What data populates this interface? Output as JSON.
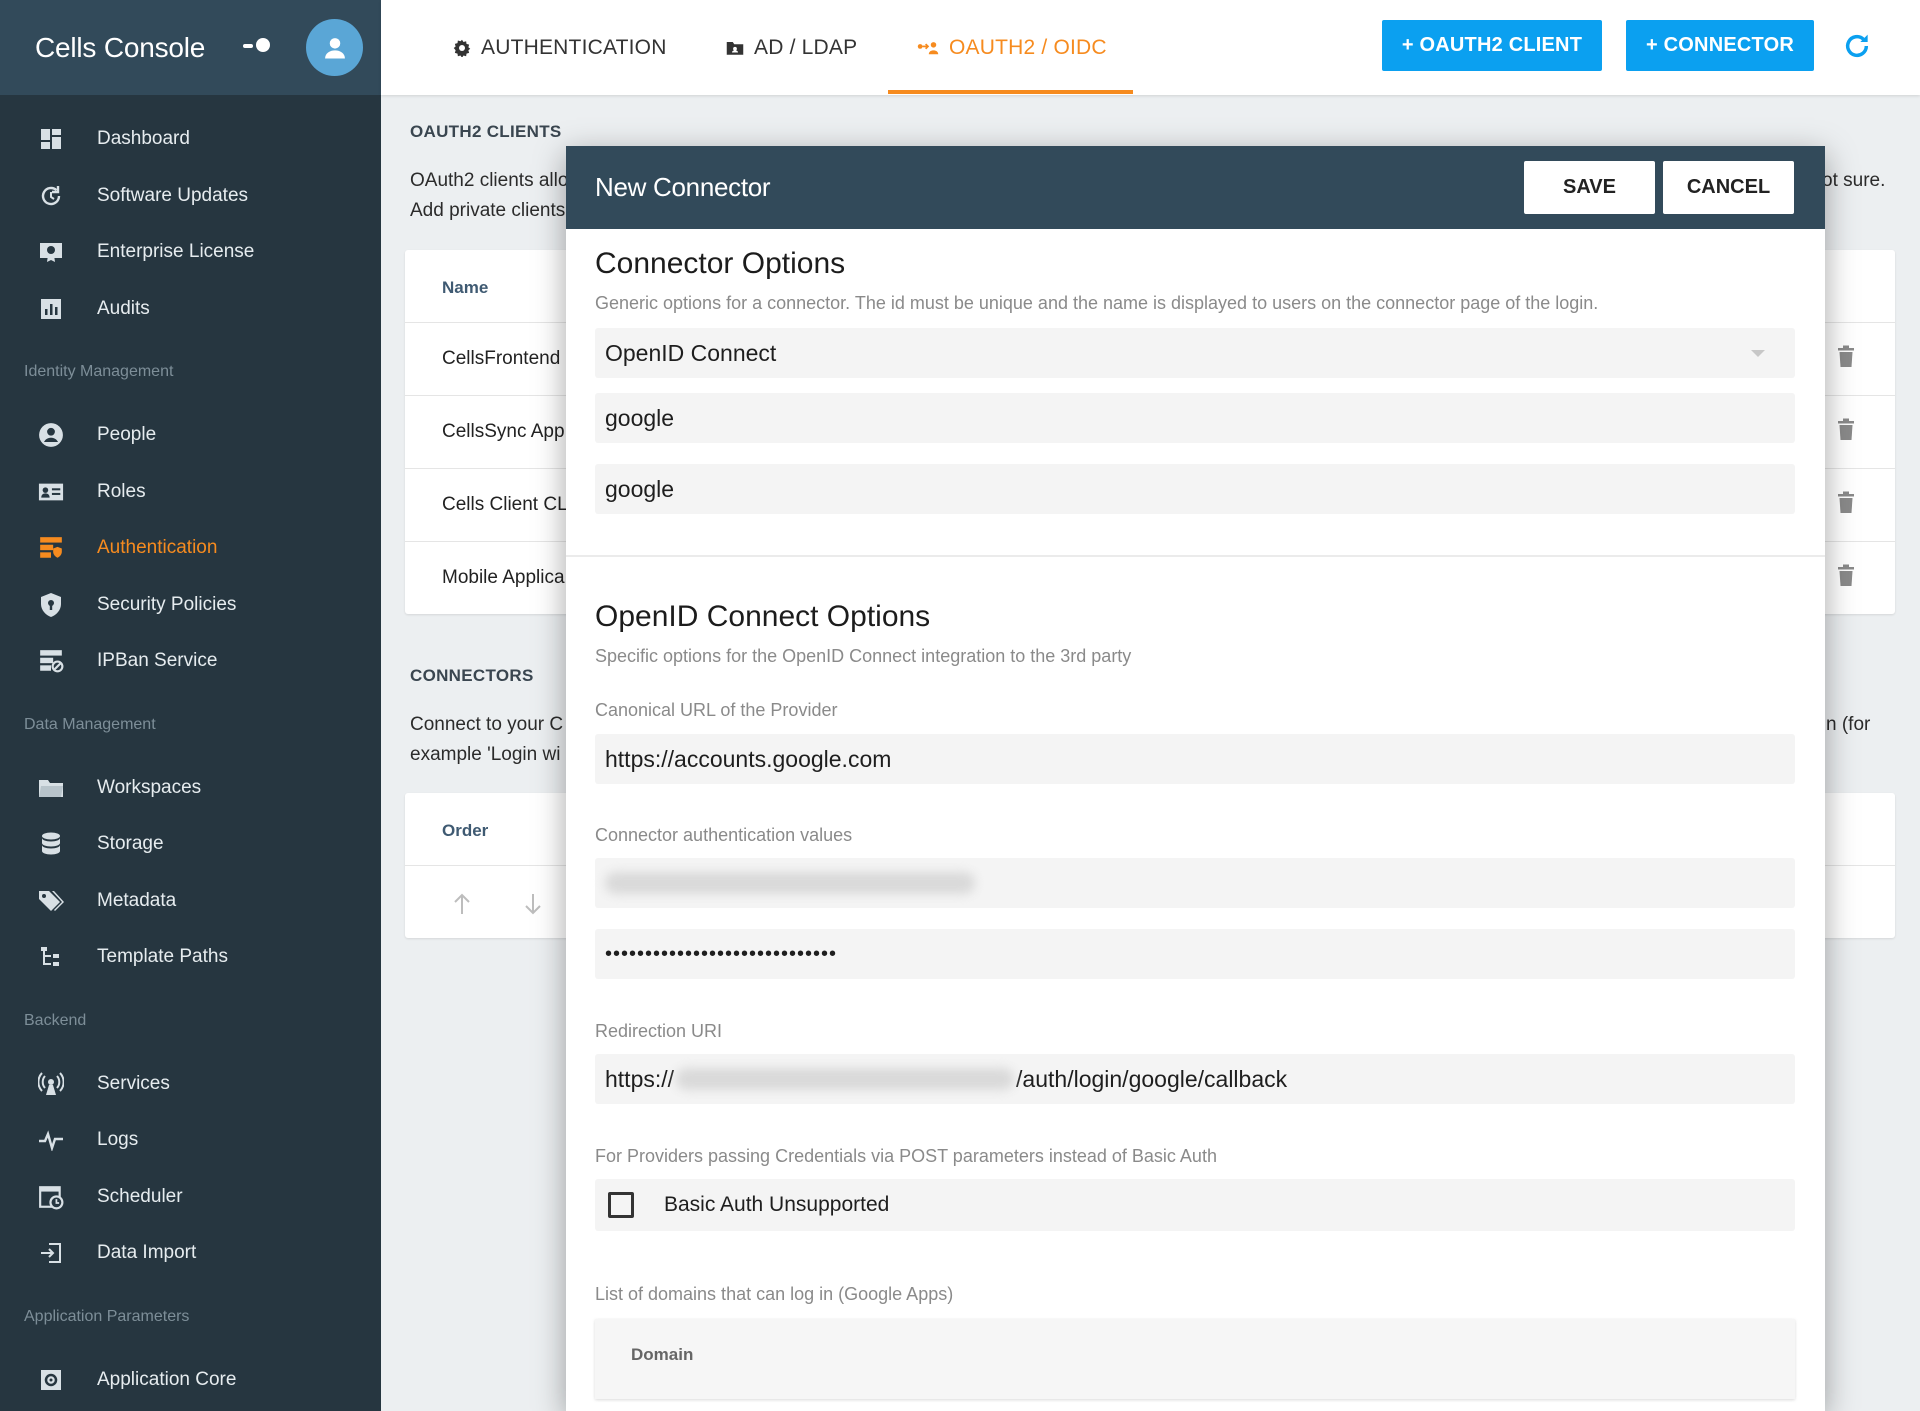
{
  "app": {
    "title": "Cells Console"
  },
  "sidebar": {
    "items_top": [
      {
        "label": "Dashboard",
        "icon": "dashboard-icon"
      },
      {
        "label": "Software Updates",
        "icon": "update-icon"
      },
      {
        "label": "Enterprise License",
        "icon": "license-icon"
      },
      {
        "label": "Audits",
        "icon": "audits-icon"
      }
    ],
    "section_identity": "Identity Management",
    "items_identity": [
      {
        "label": "People",
        "icon": "people-icon"
      },
      {
        "label": "Roles",
        "icon": "roles-icon"
      },
      {
        "label": "Authentication",
        "icon": "authentication-icon",
        "active": true
      },
      {
        "label": "Security Policies",
        "icon": "shield-icon"
      },
      {
        "label": "IPBan Service",
        "icon": "ipban-icon"
      }
    ],
    "section_data": "Data Management",
    "items_data": [
      {
        "label": "Workspaces",
        "icon": "folder-icon"
      },
      {
        "label": "Storage",
        "icon": "database-icon"
      },
      {
        "label": "Metadata",
        "icon": "tags-icon"
      },
      {
        "label": "Template Paths",
        "icon": "tree-icon"
      }
    ],
    "section_backend": "Backend",
    "items_backend": [
      {
        "label": "Services",
        "icon": "services-icon"
      },
      {
        "label": "Logs",
        "icon": "pulse-icon"
      },
      {
        "label": "Scheduler",
        "icon": "scheduler-icon"
      },
      {
        "label": "Data Import",
        "icon": "import-icon"
      }
    ],
    "section_app": "Application Parameters",
    "items_app": [
      {
        "label": "Application Core",
        "icon": "gear-icon"
      }
    ]
  },
  "topbar": {
    "tabs": [
      {
        "label": "AUTHENTICATION",
        "icon": "gear-icon"
      },
      {
        "label": "AD / LDAP",
        "icon": "ldap-folder-icon"
      },
      {
        "label": "OAUTH2 / OIDC",
        "icon": "oauth-icon",
        "active": true
      }
    ],
    "add_client_label": "+ OAUTH2 CLIENT",
    "add_connector_label": "+ CONNECTOR",
    "accent_color": "#f68b1f",
    "button_color": "#0ba0f0"
  },
  "background": {
    "clients_title": "OAUTH2 CLIENTS",
    "clients_desc_line1": "OAuth2 clients allo",
    "clients_desc_line2": "Add private clients",
    "clients_desc_tail": "ot sure.",
    "clients_table": {
      "header": "Name",
      "rows": [
        "CellsFrontend",
        "CellsSync App",
        "Cells Client CL",
        "Mobile Applica"
      ]
    },
    "connectors_title": "CONNECTORS",
    "connectors_desc_line1": "Connect to your C",
    "connectors_desc_line2": "example 'Login wi",
    "connectors_desc_tail": "n (for",
    "connectors_table": {
      "header": "Order"
    }
  },
  "dialog": {
    "title": "New Connector",
    "save_label": "SAVE",
    "cancel_label": "CANCEL",
    "connector_options": {
      "heading": "Connector Options",
      "description": "Generic options for a connector. The id must be unique and the name is displayed to users on the connector page of the login.",
      "type_value": "OpenID Connect",
      "id_value": "google",
      "name_value": "google"
    },
    "oidc_options": {
      "heading": "OpenID Connect Options",
      "description": "Specific options for the OpenID Connect integration to the 3rd party",
      "issuer_label": "Canonical URL of the Provider",
      "issuer_value": "https://accounts.google.com",
      "auth_values_label": "Connector authentication values",
      "client_secret_value": "•••••••••••••••••••••••••••••",
      "redirect_label": "Redirection URI",
      "redirect_prefix": "https://",
      "redirect_suffix": "/auth/login/google/callback",
      "post_creds_label": "For Providers passing Credentials via POST parameters instead of Basic Auth",
      "basic_auth_label": "Basic Auth Unsupported",
      "basic_auth_checked": false,
      "domains_label": "List of domains that can log in (Google Apps)",
      "domains_header": "Domain"
    }
  }
}
